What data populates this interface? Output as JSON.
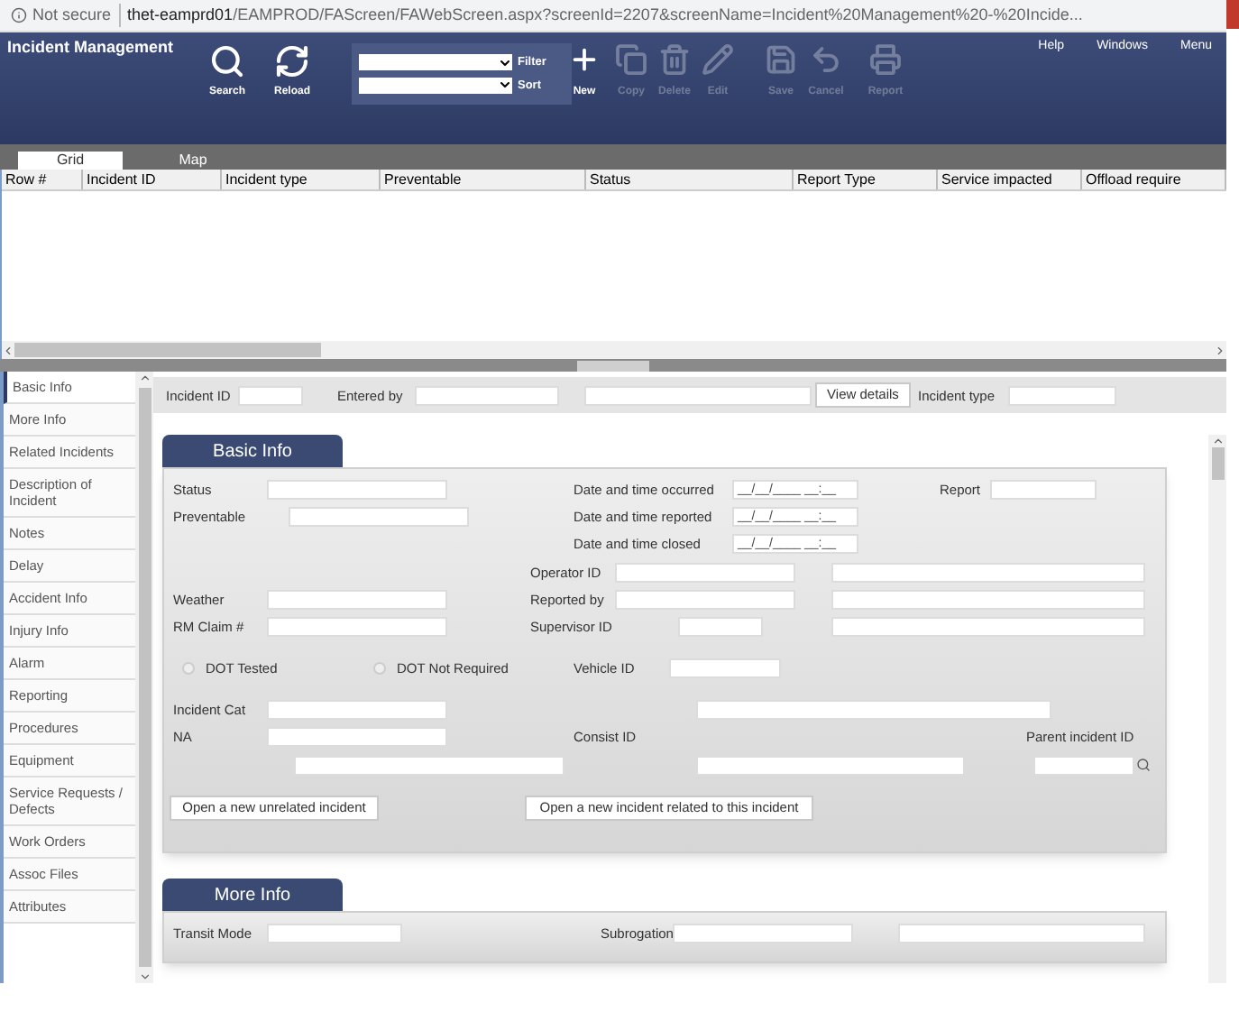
{
  "address_bar": {
    "security": "Not secure",
    "url_host": "thet-eamprd01",
    "url_path": "/EAMPROD/FAScreen/FAWebScreen.aspx?screenId=2207&screenName=Incident%20Management%20-%20Incide..."
  },
  "header": {
    "title": "Incident Management",
    "menu": [
      "Help",
      "Windows",
      "Menu"
    ]
  },
  "toolbar": {
    "left": [
      {
        "kind": "search",
        "label": "Search",
        "disabled": false
      },
      {
        "kind": "reload",
        "label": "Reload",
        "disabled": false
      }
    ],
    "filter": {
      "label": "Filter"
    },
    "sort": {
      "label": "Sort"
    },
    "right": [
      {
        "kind": "new",
        "label": "New",
        "disabled": false
      },
      {
        "kind": "copy",
        "label": "Copy",
        "disabled": true
      },
      {
        "kind": "delete",
        "label": "Delete",
        "disabled": true
      },
      {
        "kind": "edit",
        "label": "Edit",
        "disabled": true
      },
      {
        "kind": "save",
        "label": "Save",
        "disabled": true
      },
      {
        "kind": "cancel",
        "label": "Cancel",
        "disabled": true
      },
      {
        "kind": "report",
        "label": "Report",
        "disabled": true
      }
    ]
  },
  "view_tabs": [
    {
      "label": "Grid",
      "selected": true
    },
    {
      "label": "Map",
      "selected": false
    }
  ],
  "table": {
    "columns": [
      "Row #",
      "Incident ID",
      "Incident type",
      "Preventable",
      "Status",
      "Report Type",
      "Service impacted",
      "Offload require"
    ]
  },
  "sidebar": {
    "items": [
      {
        "label": "Basic Info",
        "selected": true
      },
      {
        "label": "More Info",
        "selected": false
      },
      {
        "label": "Related Incidents",
        "selected": false
      },
      {
        "label": "Description of Incident",
        "selected": false
      },
      {
        "label": "Notes",
        "selected": false
      },
      {
        "label": "Delay",
        "selected": false
      },
      {
        "label": "Accident Info",
        "selected": false
      },
      {
        "label": "Injury Info",
        "selected": false
      },
      {
        "label": "Alarm",
        "selected": false
      },
      {
        "label": "Reporting",
        "selected": false
      },
      {
        "label": "Procedures",
        "selected": false
      },
      {
        "label": "Equipment",
        "selected": false
      },
      {
        "label": "Service Requests / Defects",
        "selected": false
      },
      {
        "label": "Work Orders",
        "selected": false
      },
      {
        "label": "Assoc Files",
        "selected": false
      },
      {
        "label": "Attributes",
        "selected": false
      }
    ]
  },
  "info_bar": [
    {
      "kind": "label",
      "text": "Incident ID"
    },
    {
      "kind": "input"
    },
    {
      "kind": "label",
      "text": "Entered by"
    },
    {
      "kind": "input"
    },
    {
      "kind": "input"
    },
    {
      "kind": "button",
      "text": "View details"
    },
    {
      "kind": "label",
      "text": "Incident type"
    },
    {
      "kind": "input"
    }
  ],
  "basic_info": {
    "title": "Basic Info",
    "rows": [
      [
        {
          "kind": "label",
          "text": "Status"
        },
        {
          "kind": "input"
        },
        {
          "kind": "label",
          "text": "Date and time occurred"
        },
        {
          "kind": "date",
          "value": "__/__/____ __:__"
        },
        {
          "kind": "label",
          "text": "Report"
        },
        {
          "kind": "input"
        }
      ],
      [
        {
          "kind": "label",
          "text": "Preventable"
        },
        {
          "kind": "input"
        },
        {
          "kind": "label",
          "text": "Date and time reported"
        },
        {
          "kind": "date",
          "value": "__/__/____ __:__"
        }
      ],
      [
        {
          "kind": "label",
          "text": "Date and time closed"
        },
        {
          "kind": "date",
          "value": "__/__/____ __:__"
        }
      ],
      [
        {
          "kind": "label",
          "text": "Operator ID"
        },
        {
          "kind": "input"
        },
        {
          "kind": "input"
        }
      ],
      [
        {
          "kind": "label",
          "text": "Weather"
        },
        {
          "kind": "input"
        },
        {
          "kind": "label",
          "text": "Reported by"
        },
        {
          "kind": "input"
        },
        {
          "kind": "input"
        }
      ],
      [
        {
          "kind": "label",
          "text": "RM Claim #"
        },
        {
          "kind": "input"
        },
        {
          "kind": "label",
          "text": "Supervisor ID"
        },
        {
          "kind": "input"
        },
        {
          "kind": "input"
        }
      ],
      [
        {
          "kind": "radio",
          "text": "DOT Tested",
          "checked": false
        },
        {
          "kind": "radio",
          "text": "DOT Not Required",
          "checked": false
        },
        {
          "kind": "label",
          "text": "Vehicle ID"
        },
        {
          "kind": "input"
        }
      ],
      [
        {
          "kind": "label",
          "text": "Incident Cat"
        },
        {
          "kind": "input"
        },
        {
          "kind": "input"
        }
      ],
      [
        {
          "kind": "label",
          "text": "NA"
        },
        {
          "kind": "input"
        },
        {
          "kind": "label",
          "text": "Consist ID"
        },
        {
          "kind": "label",
          "text": "Parent incident ID"
        }
      ],
      [
        {
          "kind": "input"
        },
        {
          "kind": "input"
        },
        {
          "kind": "lookup"
        }
      ],
      [
        {
          "kind": "button",
          "text": "Open a new unrelated incident"
        },
        {
          "kind": "button",
          "text": "Open a new incident related to this incident"
        }
      ]
    ]
  },
  "more_info": {
    "title": "More Info",
    "rows": [
      [
        {
          "kind": "label",
          "text": "Transit Mode"
        },
        {
          "kind": "input"
        },
        {
          "kind": "label",
          "text": "Subrogation"
        },
        {
          "kind": "input"
        },
        {
          "kind": "input"
        }
      ]
    ]
  }
}
